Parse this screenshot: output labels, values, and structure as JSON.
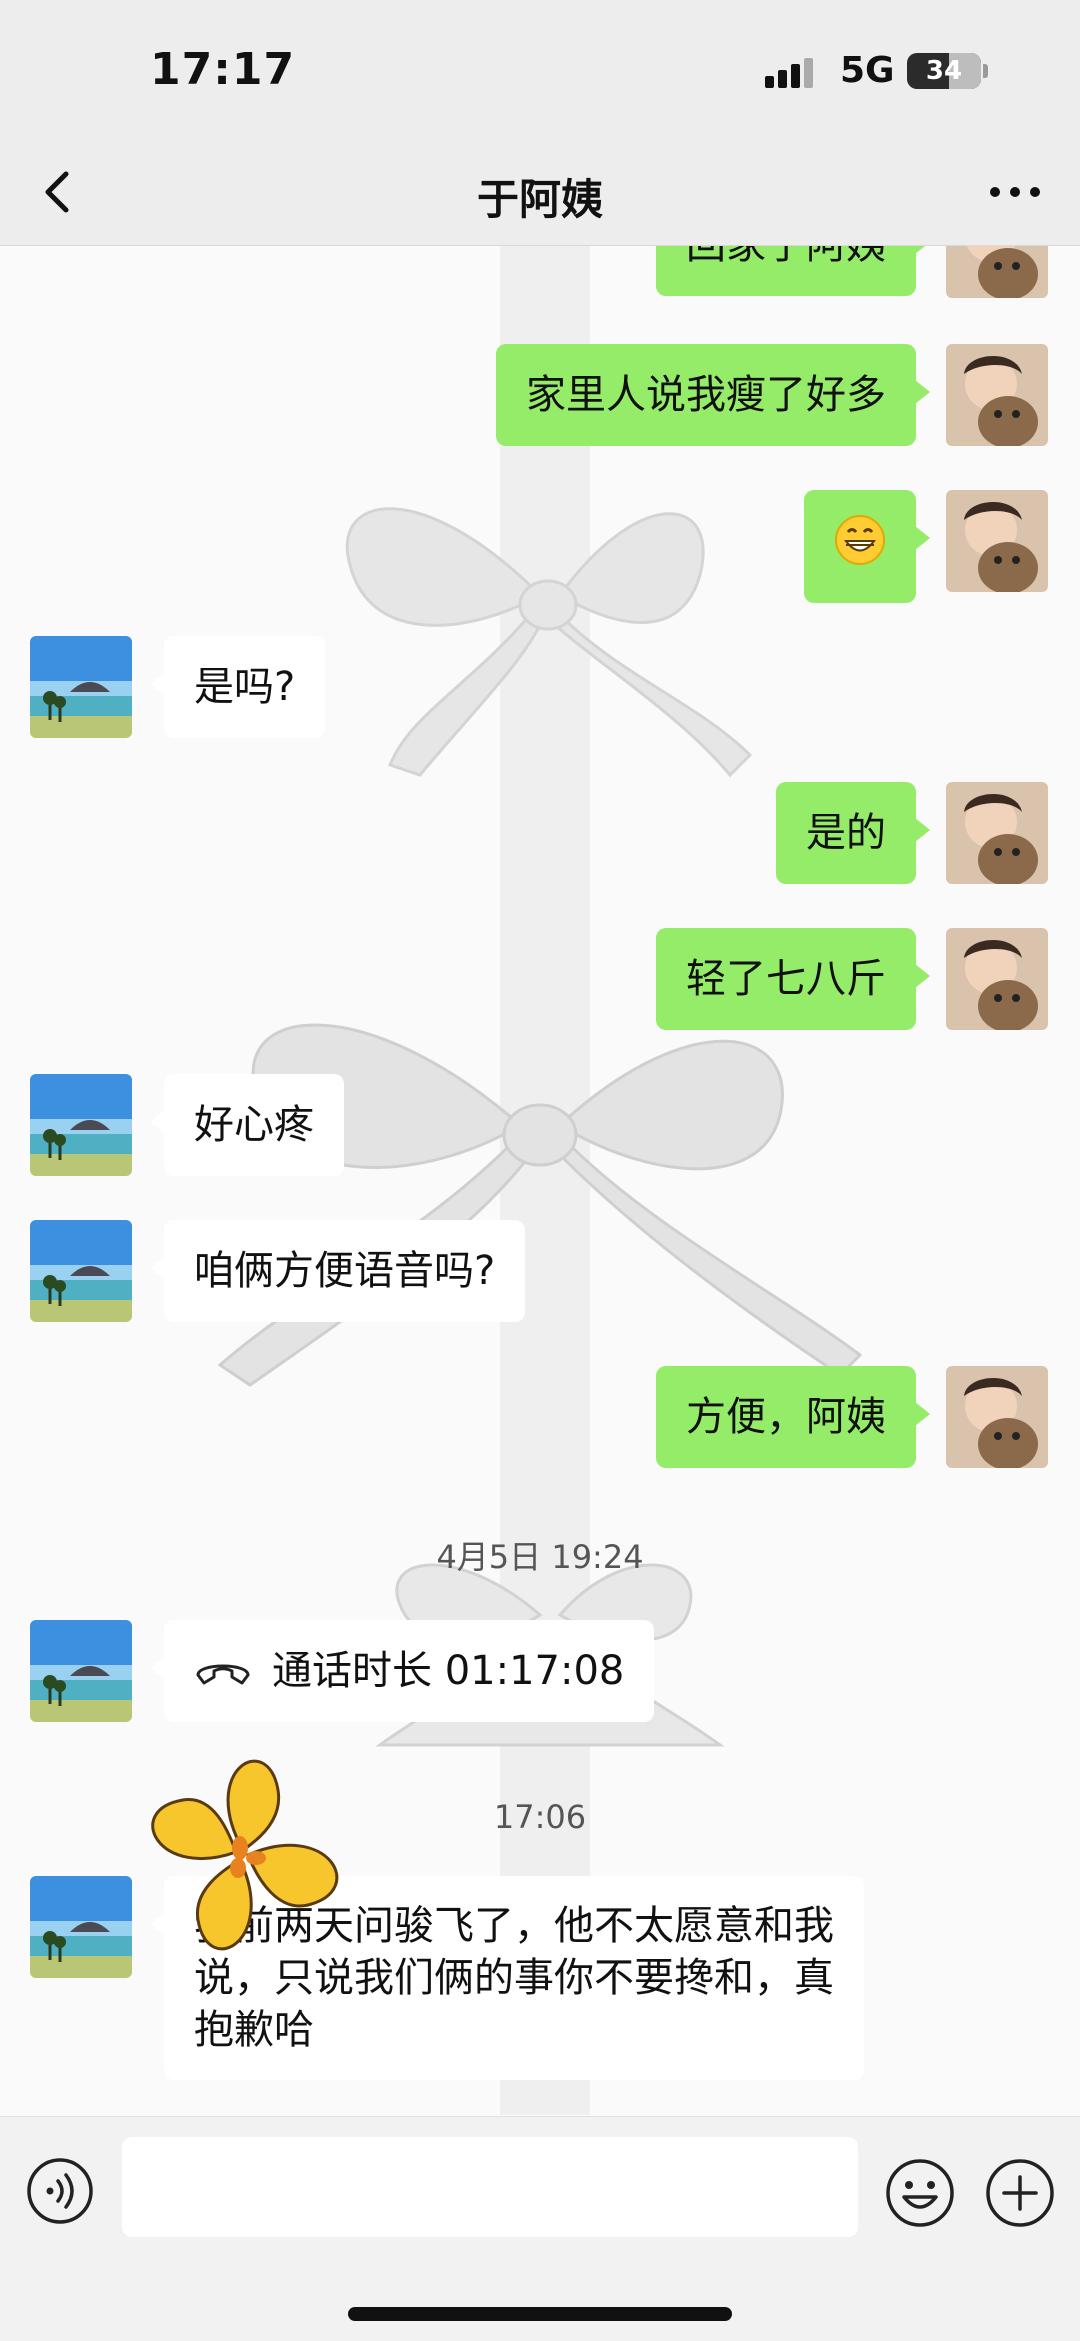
{
  "status_bar": {
    "time": "17:17",
    "network": "5G",
    "battery": "34"
  },
  "header": {
    "title": "于阿姨"
  },
  "messages": {
    "m1": "回家了阿姨",
    "m2": "家里人说我瘦了好多",
    "m3": "😁",
    "m4": "是吗?",
    "m5": "是的",
    "m6": "轻了七八斤",
    "m7": "好心疼",
    "m8": "咱俩方便语音吗?",
    "m9": "方便，阿姨",
    "ts1": "4月5日 19:24",
    "call": "通话时长 01:17:08",
    "ts2": "17:06",
    "m10": "我前两天问骏飞了，他不太愿意和我说，只说我们俩的事你不要搀和，真抱歉哈"
  },
  "icons": {
    "back": "chevron-left-icon",
    "more": "more-dots-icon",
    "voice": "voice-icon",
    "emoji": "emoji-icon",
    "plus": "plus-icon",
    "call": "phone-icon"
  },
  "colors": {
    "my_bubble": "#95ec69",
    "their_bubble": "#ffffff",
    "header_bg": "#ededed"
  }
}
